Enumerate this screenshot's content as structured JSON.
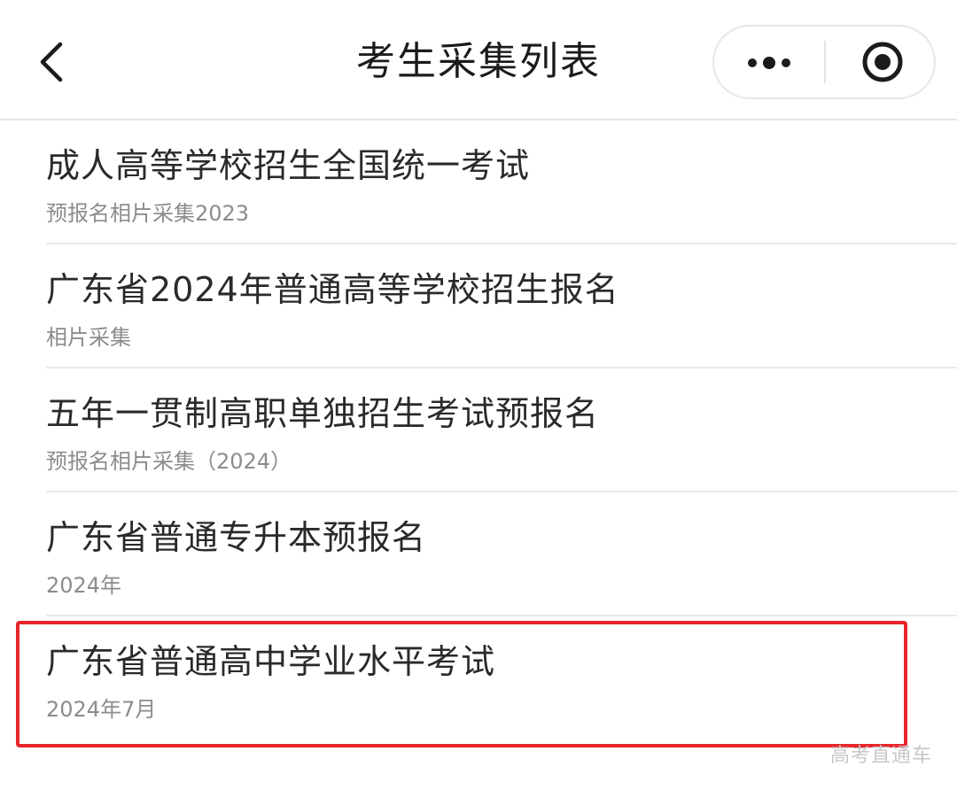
{
  "header": {
    "title": "考生采集列表"
  },
  "list": {
    "items": [
      {
        "title": "成人高等学校招生全国统一考试",
        "subtitle": "预报名相片采集2023"
      },
      {
        "title": "广东省2024年普通高等学校招生报名",
        "subtitle": "相片采集"
      },
      {
        "title": "五年一贯制高职单独招生考试预报名",
        "subtitle": "预报名相片采集（2024）"
      },
      {
        "title": "广东省普通专升本预报名",
        "subtitle": "2024年"
      },
      {
        "title": "广东省普通高中学业水平考试",
        "subtitle": "2024年7月"
      }
    ]
  },
  "highlight": {
    "color": "#e8262a"
  },
  "watermark": {
    "text": "高考直通车"
  },
  "icons": {
    "back": "chevron-left-icon",
    "more": "more-dots-icon",
    "close": "target-circle-icon"
  }
}
